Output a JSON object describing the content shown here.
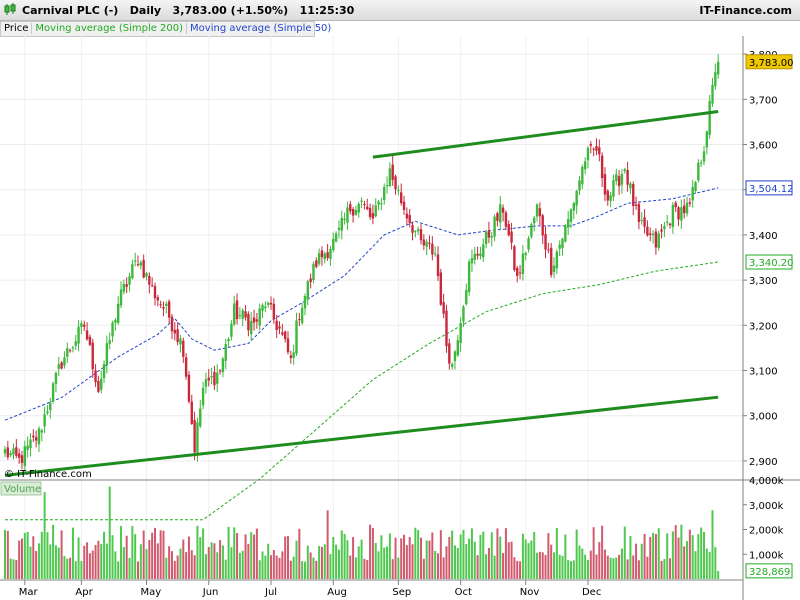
{
  "header": {
    "title": "Carnival PLC (-)   Daily   3,783.00 (+1.50%)   11:25:30",
    "brand": "IT-Finance.com"
  },
  "legend": {
    "price": "Price",
    "ma200": "Moving average (Simple 200)",
    "ma50": "Moving average (Simple 50)"
  },
  "watermark": "© IT-Finance.com",
  "volume_label": "Volume",
  "colors": {
    "up": "#3cb83c",
    "down": "#c8283c",
    "ma200": "#22aa22",
    "ma50": "#2244cc",
    "trend": "#1e8c1e"
  },
  "chart_data": {
    "type": "candlestick",
    "y_ticks": [
      "2,900",
      "3,000",
      "3,100",
      "3,200",
      "3,300",
      "3,400",
      "3,500",
      "3,600",
      "3,700",
      "3,800"
    ],
    "ylim": [
      2860,
      3840
    ],
    "months": [
      "Mar",
      "Apr",
      "May",
      "Jun",
      "Jul",
      "Aug",
      "Sep",
      "Oct",
      "Nov",
      "Dec"
    ],
    "price_badges": {
      "last": "3,783.00",
      "ma50": "3,504.12",
      "ma200": "3,340.20"
    },
    "close_path": [
      [
        0,
        2920
      ],
      [
        5,
        2900
      ],
      [
        12,
        2960
      ],
      [
        20,
        3120
      ],
      [
        28,
        3200
      ],
      [
        33,
        3060
      ],
      [
        40,
        3250
      ],
      [
        47,
        3350
      ],
      [
        52,
        3280
      ],
      [
        58,
        3220
      ],
      [
        63,
        3150
      ],
      [
        67,
        2930
      ],
      [
        70,
        3060
      ],
      [
        76,
        3100
      ],
      [
        81,
        3230
      ],
      [
        88,
        3200
      ],
      [
        92,
        3250
      ],
      [
        97,
        3190
      ],
      [
        101,
        3120
      ],
      [
        104,
        3230
      ],
      [
        110,
        3340
      ],
      [
        117,
        3390
      ],
      [
        122,
        3460
      ],
      [
        126,
        3470
      ],
      [
        130,
        3430
      ],
      [
        136,
        3540
      ],
      [
        141,
        3460
      ],
      [
        147,
        3380
      ],
      [
        152,
        3360
      ],
      [
        156,
        3160
      ],
      [
        158,
        3110
      ],
      [
        164,
        3330
      ],
      [
        170,
        3390
      ],
      [
        176,
        3460
      ],
      [
        181,
        3300
      ],
      [
        188,
        3460
      ],
      [
        193,
        3330
      ],
      [
        199,
        3430
      ],
      [
        205,
        3570
      ],
      [
        209,
        3590
      ],
      [
        213,
        3480
      ],
      [
        219,
        3550
      ],
      [
        224,
        3420
      ],
      [
        230,
        3380
      ],
      [
        236,
        3450
      ],
      [
        242,
        3460
      ],
      [
        247,
        3600
      ],
      [
        251,
        3760
      ],
      [
        252,
        3783
      ]
    ],
    "ma50": [
      [
        0,
        2990
      ],
      [
        20,
        3040
      ],
      [
        40,
        3130
      ],
      [
        54,
        3180
      ],
      [
        60,
        3215
      ],
      [
        66,
        3170
      ],
      [
        74,
        3145
      ],
      [
        86,
        3160
      ],
      [
        94,
        3210
      ],
      [
        105,
        3250
      ],
      [
        120,
        3310
      ],
      [
        134,
        3400
      ],
      [
        145,
        3430
      ],
      [
        160,
        3400
      ],
      [
        172,
        3410
      ],
      [
        188,
        3420
      ],
      [
        200,
        3420
      ],
      [
        209,
        3440
      ],
      [
        220,
        3470
      ],
      [
        236,
        3480
      ],
      [
        252,
        3504
      ]
    ],
    "ma200": [
      [
        0,
        2770
      ],
      [
        40,
        2770
      ],
      [
        70,
        2770
      ],
      [
        90,
        2860
      ],
      [
        110,
        2970
      ],
      [
        130,
        3080
      ],
      [
        150,
        3160
      ],
      [
        170,
        3230
      ],
      [
        190,
        3270
      ],
      [
        210,
        3290
      ],
      [
        230,
        3320
      ],
      [
        252,
        3340
      ]
    ],
    "trendlines": [
      {
        "from": [
          0,
          2868
        ],
        "to": [
          252,
          3041
        ]
      },
      {
        "from": [
          130,
          3572
        ],
        "to": [
          252,
          3673
        ]
      }
    ],
    "volume_ticks": [
      "1,000k",
      "2,000k",
      "3,000k",
      "4,000k"
    ],
    "volume_badge": "328,869",
    "volume_max": 4000000
  }
}
